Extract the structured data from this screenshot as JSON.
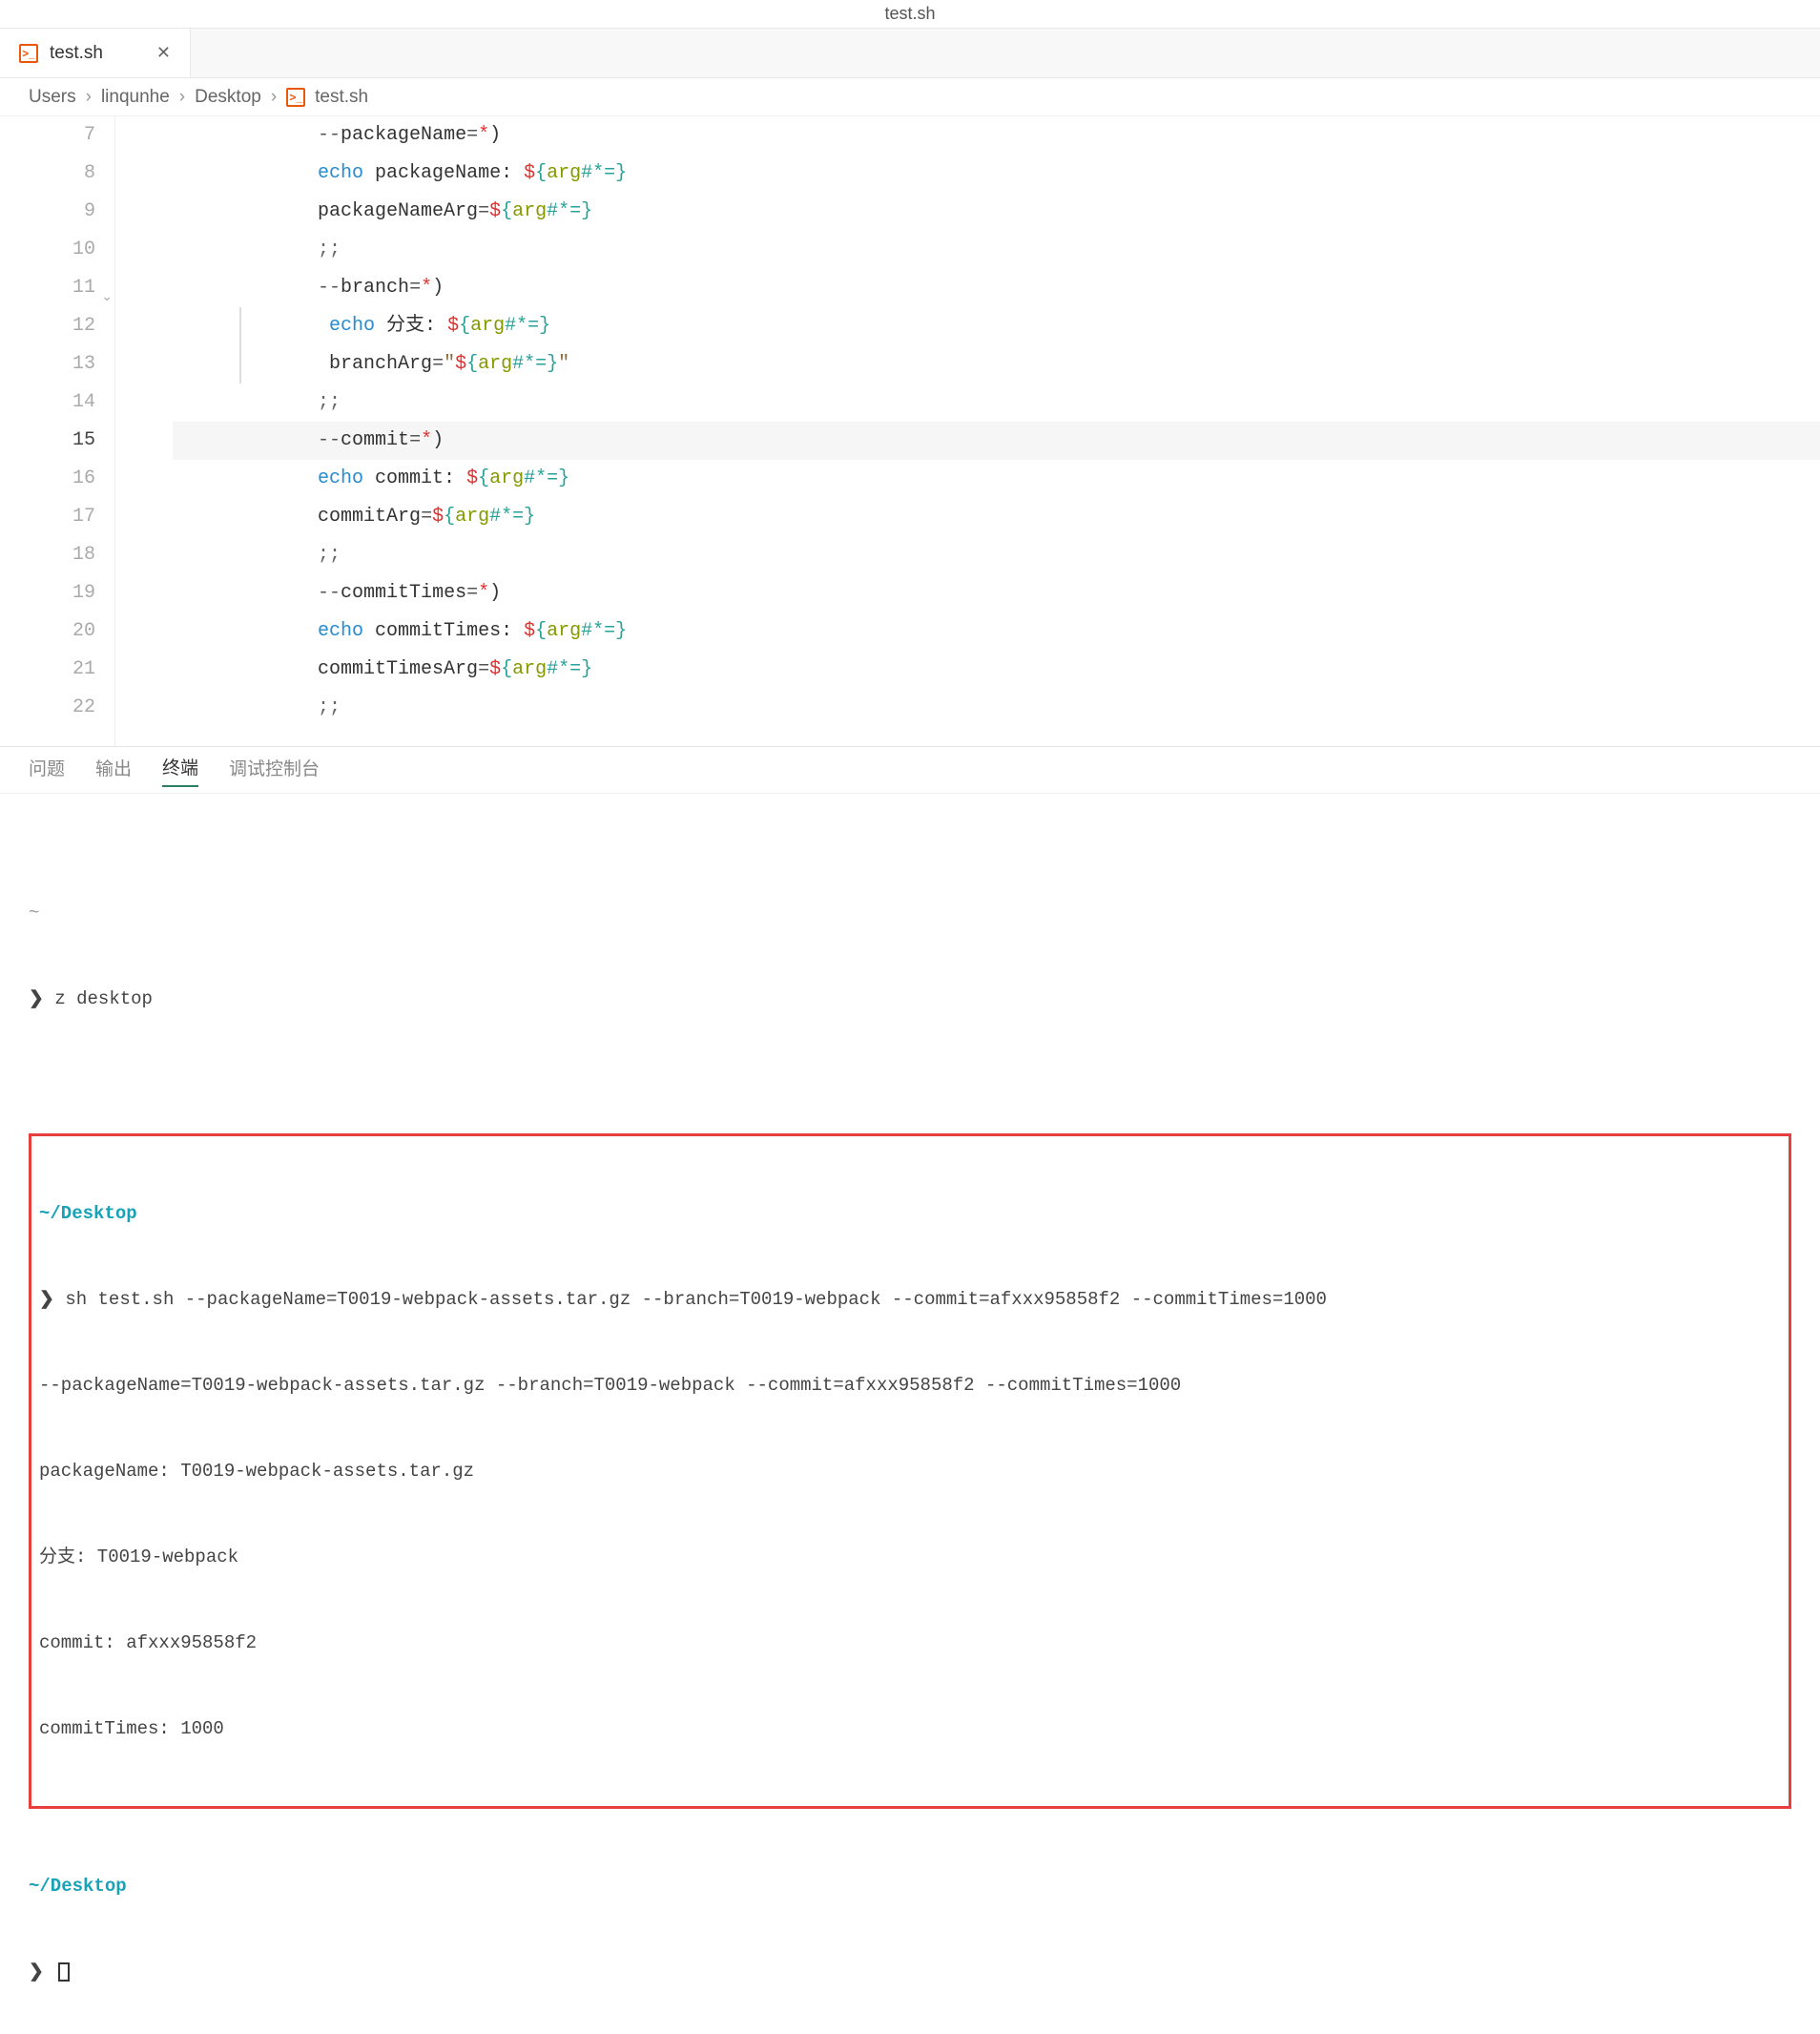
{
  "window": {
    "title": "test.sh"
  },
  "tab": {
    "label": "test.sh",
    "icon": "shell-icon"
  },
  "breadcrumbs": {
    "items": [
      "Users",
      "linqunhe",
      "Desktop",
      "test.sh"
    ]
  },
  "editor": {
    "currentLine": 15,
    "lines": [
      {
        "num": 7,
        "indent": "            ",
        "tokens": [
          [
            "op",
            "--"
          ],
          [
            "text",
            "packageName"
          ],
          [
            "op",
            "="
          ],
          [
            "red",
            "*"
          ],
          [
            "punc",
            ")"
          ]
        ]
      },
      {
        "num": 8,
        "indent": "            ",
        "tokens": [
          [
            "kw",
            "echo"
          ],
          [
            "text",
            " packageName: "
          ],
          [
            "red",
            "$"
          ],
          [
            "teal",
            "{"
          ],
          [
            "green",
            "arg"
          ],
          [
            "teal",
            "#*="
          ],
          [
            "teal",
            "}"
          ]
        ]
      },
      {
        "num": 9,
        "indent": "            ",
        "tokens": [
          [
            "text",
            "packageNameArg"
          ],
          [
            "op",
            "="
          ],
          [
            "red",
            "$"
          ],
          [
            "teal",
            "{"
          ],
          [
            "green",
            "arg"
          ],
          [
            "teal",
            "#*="
          ],
          [
            "teal",
            "}"
          ]
        ]
      },
      {
        "num": 10,
        "indent": "            ",
        "tokens": [
          [
            "gray",
            ";;"
          ]
        ]
      },
      {
        "num": 11,
        "indent": "            ",
        "tokens": [
          [
            "op",
            "--"
          ],
          [
            "text",
            "branch"
          ],
          [
            "op",
            "="
          ],
          [
            "red",
            "*"
          ],
          [
            "punc",
            ")"
          ]
        ],
        "fold": true
      },
      {
        "num": 12,
        "indent": "             ",
        "tokens": [
          [
            "kw",
            "echo"
          ],
          [
            "text",
            " 分支: "
          ],
          [
            "red",
            "$"
          ],
          [
            "teal",
            "{"
          ],
          [
            "green",
            "arg"
          ],
          [
            "teal",
            "#*="
          ],
          [
            "teal",
            "}"
          ]
        ],
        "guided": true
      },
      {
        "num": 13,
        "indent": "             ",
        "tokens": [
          [
            "text",
            "branchArg"
          ],
          [
            "op",
            "="
          ],
          [
            "str",
            "\""
          ],
          [
            "red",
            "$"
          ],
          [
            "teal",
            "{"
          ],
          [
            "green",
            "arg"
          ],
          [
            "teal",
            "#*="
          ],
          [
            "teal",
            "}"
          ],
          [
            "str",
            "\""
          ]
        ],
        "guided": true
      },
      {
        "num": 14,
        "indent": "            ",
        "tokens": [
          [
            "gray",
            ";;"
          ]
        ]
      },
      {
        "num": 15,
        "indent": "            ",
        "tokens": [
          [
            "op",
            "--"
          ],
          [
            "text",
            "commit"
          ],
          [
            "op",
            "="
          ],
          [
            "red",
            "*"
          ],
          [
            "punc",
            ")"
          ]
        ],
        "current": true
      },
      {
        "num": 16,
        "indent": "            ",
        "tokens": [
          [
            "kw",
            "echo"
          ],
          [
            "text",
            " commit: "
          ],
          [
            "red",
            "$"
          ],
          [
            "teal",
            "{"
          ],
          [
            "green",
            "arg"
          ],
          [
            "teal",
            "#*="
          ],
          [
            "teal",
            "}"
          ]
        ]
      },
      {
        "num": 17,
        "indent": "            ",
        "tokens": [
          [
            "text",
            "commitArg"
          ],
          [
            "op",
            "="
          ],
          [
            "red",
            "$"
          ],
          [
            "teal",
            "{"
          ],
          [
            "green",
            "arg"
          ],
          [
            "teal",
            "#*="
          ],
          [
            "teal",
            "}"
          ]
        ]
      },
      {
        "num": 18,
        "indent": "            ",
        "tokens": [
          [
            "gray",
            ";;"
          ]
        ]
      },
      {
        "num": 19,
        "indent": "            ",
        "tokens": [
          [
            "op",
            "--"
          ],
          [
            "text",
            "commitTimes"
          ],
          [
            "op",
            "="
          ],
          [
            "red",
            "*"
          ],
          [
            "punc",
            ")"
          ]
        ]
      },
      {
        "num": 20,
        "indent": "            ",
        "tokens": [
          [
            "kw",
            "echo"
          ],
          [
            "text",
            " commitTimes: "
          ],
          [
            "red",
            "$"
          ],
          [
            "teal",
            "{"
          ],
          [
            "green",
            "arg"
          ],
          [
            "teal",
            "#*="
          ],
          [
            "teal",
            "}"
          ]
        ]
      },
      {
        "num": 21,
        "indent": "            ",
        "tokens": [
          [
            "text",
            "commitTimesArg"
          ],
          [
            "op",
            "="
          ],
          [
            "red",
            "$"
          ],
          [
            "teal",
            "{"
          ],
          [
            "green",
            "arg"
          ],
          [
            "teal",
            "#*="
          ],
          [
            "teal",
            "}"
          ]
        ]
      },
      {
        "num": 22,
        "indent": "            ",
        "tokens": [
          [
            "gray",
            ";;"
          ]
        ]
      }
    ]
  },
  "panel": {
    "tabs": [
      {
        "label": "问题",
        "active": false
      },
      {
        "label": "输出",
        "active": false
      },
      {
        "label": "终端",
        "active": true
      },
      {
        "label": "调试控制台",
        "active": false
      }
    ]
  },
  "terminal": {
    "block1": {
      "tilde": "~",
      "prompt": "❯",
      "cmd": "z desktop"
    },
    "highlighted": {
      "path": "~/Desktop",
      "prompt": "❯",
      "cmd": "sh test.sh --packageName=T0019-webpack-assets.tar.gz --branch=T0019-webpack --commit=afxxx95858f2 --commitTimes=1000",
      "out1": "--packageName=T0019-webpack-assets.tar.gz --branch=T0019-webpack --commit=afxxx95858f2 --commitTimes=1000",
      "out2": "packageName: T0019-webpack-assets.tar.gz",
      "out3": "分支: T0019-webpack",
      "out4": "commit: afxxx95858f2",
      "out5": "commitTimes: 1000"
    },
    "block3": {
      "path": "~/Desktop",
      "prompt": "❯"
    }
  }
}
